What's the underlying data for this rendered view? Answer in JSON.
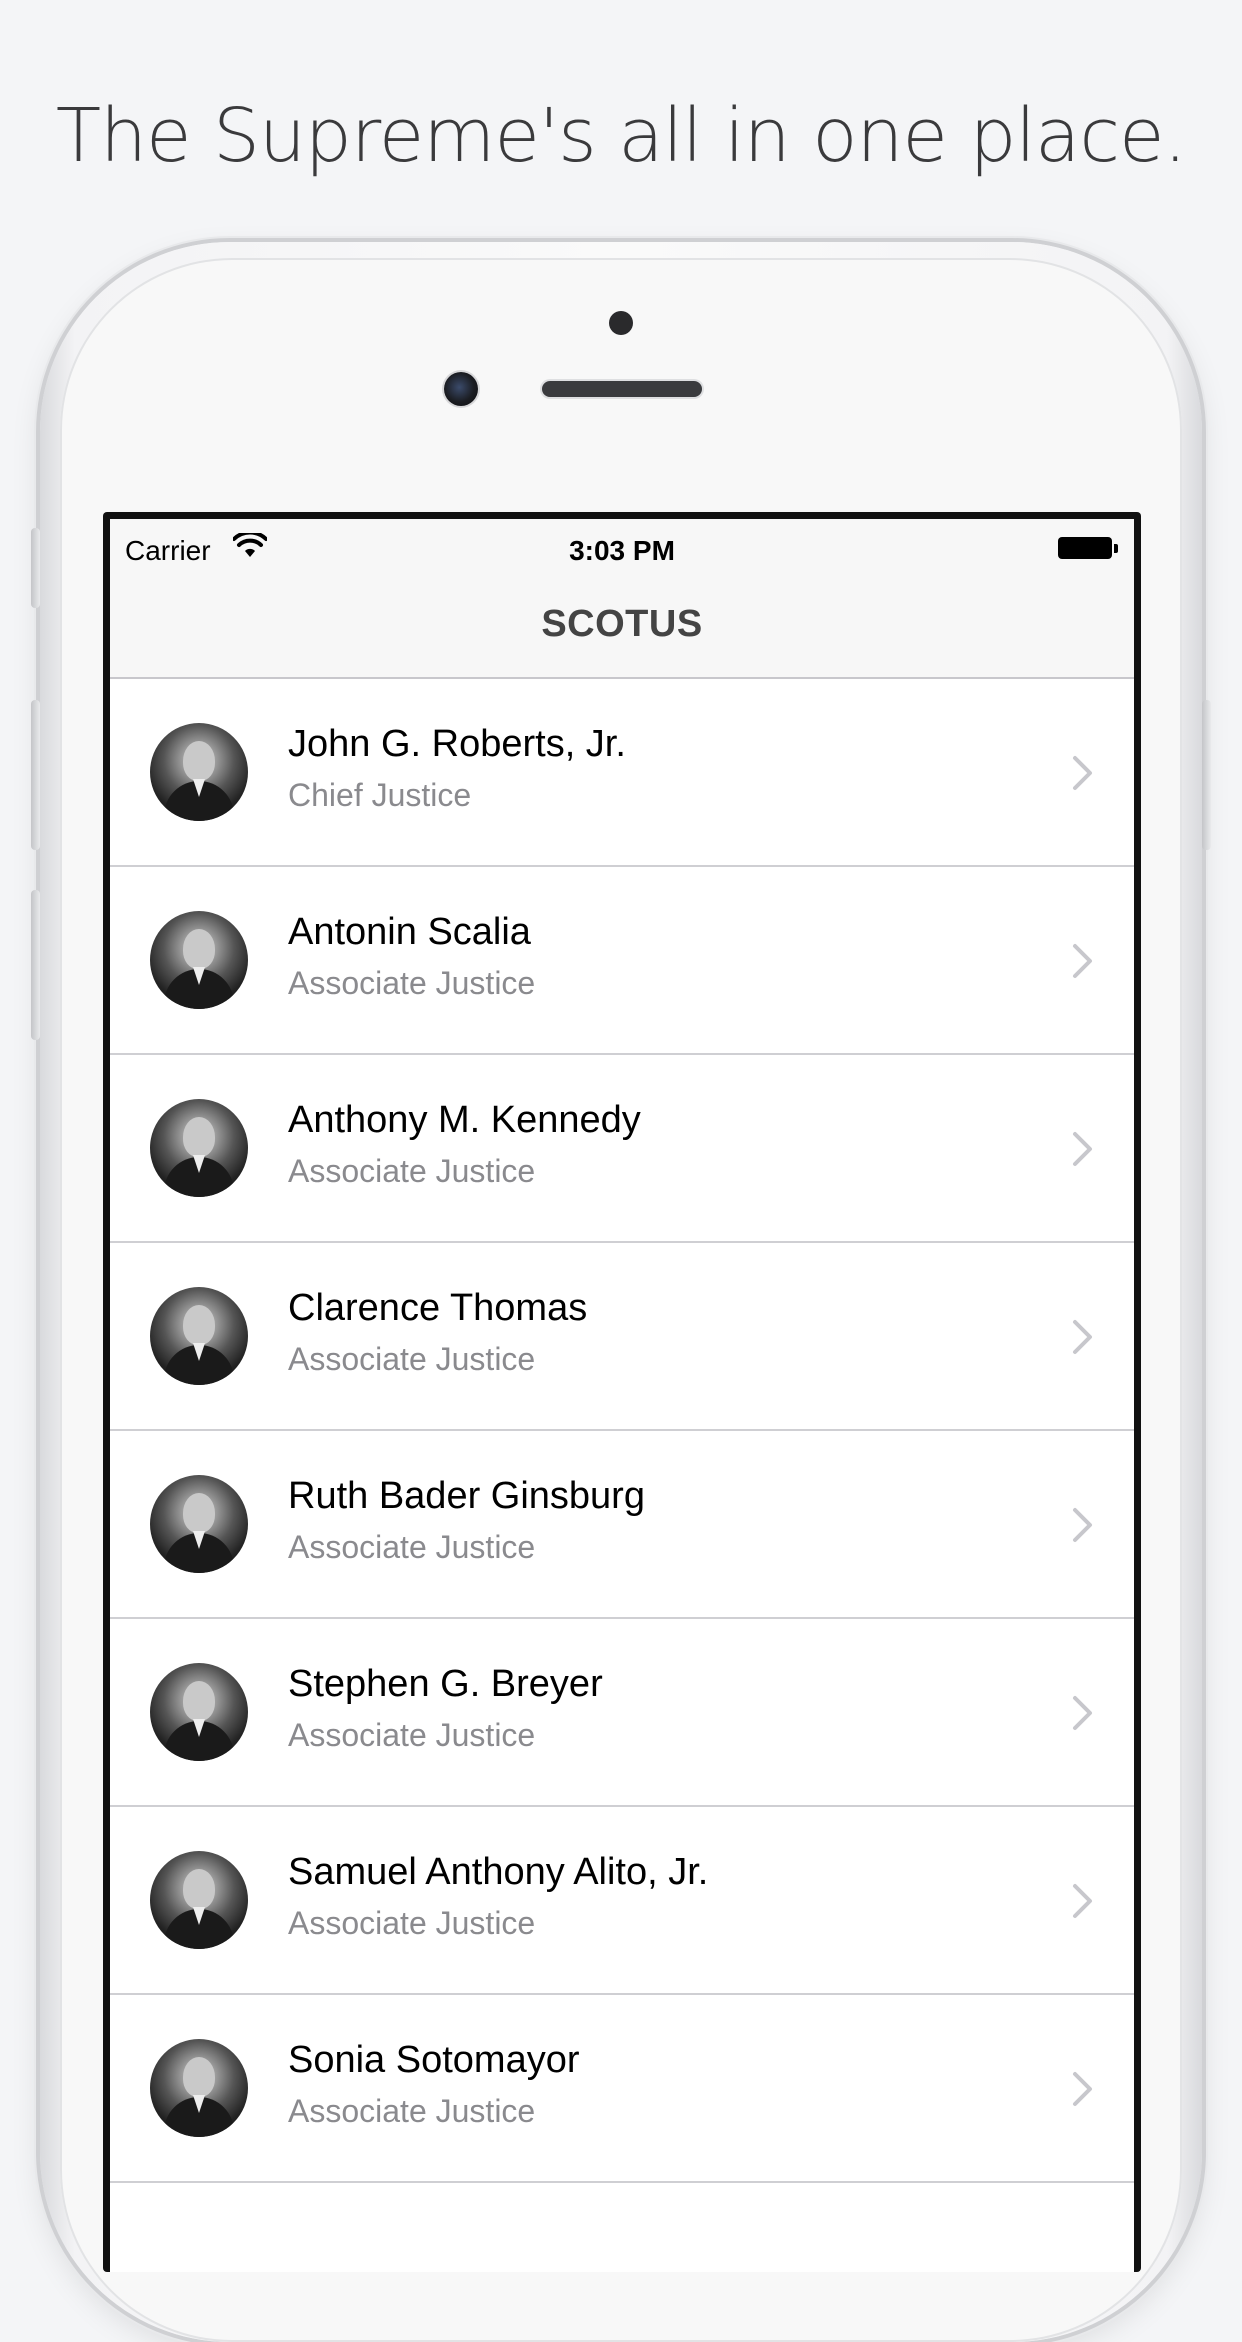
{
  "headline": "The Supreme's all in one place.",
  "status_bar": {
    "carrier": "Carrier",
    "time": "3:03 PM"
  },
  "nav": {
    "title": "SCOTUS"
  },
  "justices": [
    {
      "name": "John G. Roberts, Jr.",
      "title": "Chief Justice"
    },
    {
      "name": "Antonin Scalia",
      "title": "Associate Justice"
    },
    {
      "name": "Anthony M. Kennedy",
      "title": "Associate Justice"
    },
    {
      "name": "Clarence Thomas",
      "title": "Associate Justice"
    },
    {
      "name": "Ruth Bader Ginsburg",
      "title": "Associate Justice"
    },
    {
      "name": "Stephen G. Breyer",
      "title": "Associate Justice"
    },
    {
      "name": "Samuel Anthony Alito, Jr.",
      "title": "Associate Justice"
    },
    {
      "name": "Sonia Sotomayor",
      "title": "Associate Justice"
    }
  ],
  "icons": {
    "wifi": "wifi-icon",
    "battery": "battery-icon",
    "chevron": "chevron-right-icon"
  },
  "colors": {
    "background": "#f4f5f7",
    "nav_bar": "#f7f7f7",
    "subtitle_text": "#8a8a8e",
    "chevron": "#c7c7cc"
  }
}
